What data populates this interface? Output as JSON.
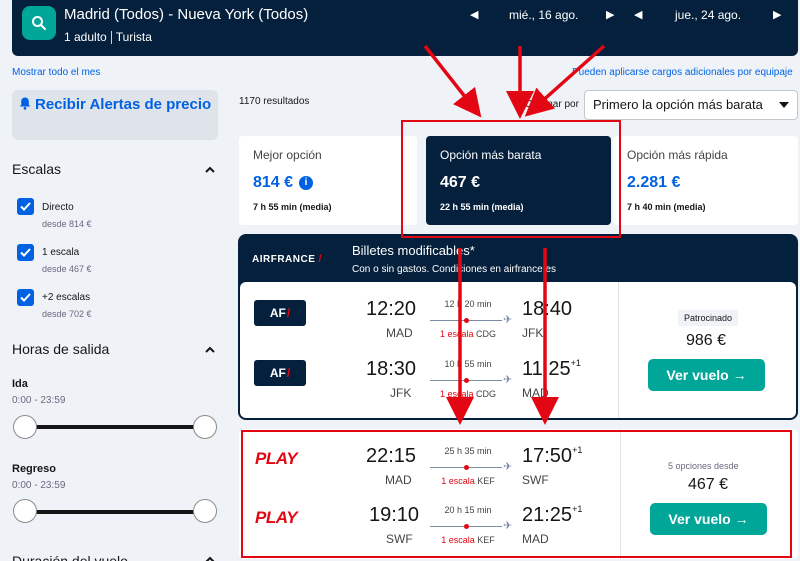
{
  "header": {
    "route": "Madrid (Todos) - Nueva York (Todos)",
    "passengers": "1 adulto",
    "cabin": "Turista",
    "depart_date": "mié., 16 ago.",
    "return_date": "jue., 24 ago."
  },
  "links": {
    "show_month": "Mostrar todo el mes",
    "fees_notice": "Pueden aplicarse cargos adicionales por equipaje"
  },
  "sidebar": {
    "alert_button": "Recibir Alertas de precio",
    "stops_title": "Escalas",
    "stops": [
      {
        "label": "Directo",
        "price": "desde 814 €",
        "checked": true
      },
      {
        "label": "1 escala",
        "price": "desde 467 €",
        "checked": true
      },
      {
        "label": "+2 escalas",
        "price": "desde 702 €",
        "checked": true
      }
    ],
    "times_title": "Horas de salida",
    "outbound_label": "Ida",
    "outbound_range": "0:00 - 23:59",
    "return_label": "Regreso",
    "return_range": "0:00 - 23:59",
    "duration_title": "Duración del vuelo"
  },
  "results": {
    "count": "1170 resultados",
    "sort_label": "Ordenar por",
    "sort_value": "Primero la opción más barata"
  },
  "sort_tabs": [
    {
      "label": "Mejor opción",
      "price": "814 €",
      "duration": "7 h 55 min (media)"
    },
    {
      "label": "Opción más barata",
      "price": "467 €",
      "duration": "22 h 55 min (media)"
    },
    {
      "label": "Opción más rápida",
      "price": "2.281 €",
      "duration": "7 h 40 min (media)"
    }
  ],
  "airfrance_ad": {
    "brand": "AIRFRANCE",
    "headline": "Billetes modificables*",
    "subline": "Con o sin gastos. Condiciones en airfrance.es",
    "logo_text": "AF",
    "legs": [
      {
        "dep_time": "12:20",
        "dep_ap": "MAD",
        "duration": "12 h 20 min",
        "stops": "1 escala",
        "via": "CDG",
        "arr_time": "18:40",
        "arr_ap": "JFK",
        "plus": ""
      },
      {
        "dep_time": "18:30",
        "dep_ap": "JFK",
        "duration": "10 h 55 min",
        "stops": "1 escala",
        "via": "CDG",
        "arr_time": "11:25",
        "arr_ap": "MAD",
        "plus": "+1"
      }
    ],
    "sponsored": "Patrocinado",
    "price": "986 €",
    "button": "Ver vuelo →"
  },
  "play_result": {
    "logo_text": "PLAY",
    "legs": [
      {
        "dep_time": "22:15",
        "dep_ap": "MAD",
        "duration": "25 h 35 min",
        "stops": "1 escala",
        "via": "KEF",
        "arr_time": "17:50",
        "arr_ap": "SWF",
        "plus": "+1"
      },
      {
        "dep_time": "19:10",
        "dep_ap": "SWF",
        "duration": "20 h 15 min",
        "stops": "1 escala",
        "via": "KEF",
        "arr_time": "21:25",
        "arr_ap": "MAD",
        "plus": "+1"
      }
    ],
    "options": "5 opciones desde",
    "price": "467 €",
    "button": "Ver vuelo →"
  },
  "colors": {
    "navy": "#05203c",
    "blue": "#0062e3",
    "teal": "#00a698",
    "annotation_red": "#e30613"
  }
}
